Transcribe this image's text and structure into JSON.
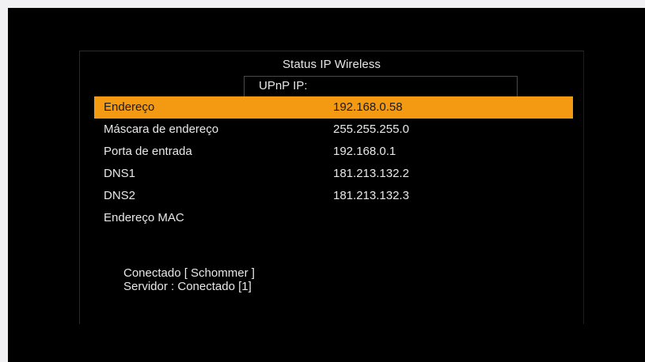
{
  "title": "Status IP Wireless",
  "upnp_label": "UPnP IP:",
  "rows": [
    {
      "label": "Endereço",
      "value": "192.168.0.58",
      "selected": true
    },
    {
      "label": "Máscara de endereço",
      "value": "255.255.255.0",
      "selected": false
    },
    {
      "label": "Porta de entrada",
      "value": "192.168.0.1",
      "selected": false
    },
    {
      "label": "DNS1",
      "value": "181.213.132.2",
      "selected": false
    },
    {
      "label": "DNS2",
      "value": "181.213.132.3",
      "selected": false
    },
    {
      "label": "Endereço MAC",
      "value": "",
      "selected": false
    }
  ],
  "status": {
    "connection": "Conectado [ Schommer ]",
    "server": "Servidor : Conectado  [1]"
  },
  "colors": {
    "highlight": "#f39a12",
    "background": "#000000",
    "text": "#e8e8e8"
  }
}
